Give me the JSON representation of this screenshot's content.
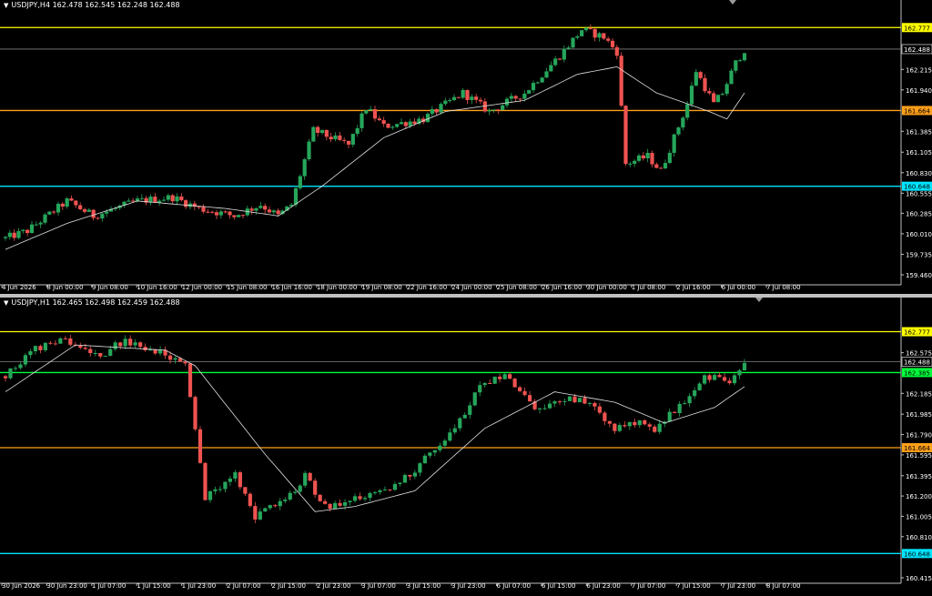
{
  "colors": {
    "background": "#000000",
    "bull": "#26a65b",
    "bear": "#ef5350",
    "ma_line": "#e0e0e0",
    "axis_text": "#ffffff",
    "yellow_level": "#ffff00",
    "orange_level": "#ff9f1a",
    "green_level": "#00ff3c",
    "cyan_level": "#00e5ff",
    "current_level": "#808080"
  },
  "panels": [
    {
      "title": "USDJPY,H4",
      "ohlc": "162.478 162.545 162.248 162.488",
      "header_icon": "dropdown-triangle-icon"
    },
    {
      "title": "USDJPY,H1",
      "ohlc": "162.465 162.498 162.459 162.488",
      "header_icon": "dropdown-triangle-icon"
    }
  ],
  "chart_data": [
    {
      "type": "candlestick",
      "symbol": "USDJPY",
      "timeframe": "H4",
      "ylim": [
        159.35,
        163.0
      ],
      "price_ticks": [
        "162.215",
        "161.940",
        "161.385",
        "161.105",
        "160.830",
        "160.555",
        "160.285",
        "160.010",
        "159.735",
        "159.460"
      ],
      "time_labels": [
        "4 Jun 2026",
        "8 Jun 00:00",
        "9 Jun 08:00",
        "10 Jun 16:00",
        "12 Jun 00:00",
        "15 Jun 08:00",
        "16 Jun 16:00",
        "18 Jun 00:00",
        "19 Jun 08:00",
        "22 Jun 16:00",
        "24 Jun 00:00",
        "25 Jun 08:00",
        "26 Jun 16:00",
        "30 Jun 00:00",
        "1 Jul 08:00",
        "2 Jul 16:00",
        "6 Jul 00:00",
        "7 Jul 08:00"
      ],
      "levels": [
        {
          "price": 162.777,
          "label": "162.777",
          "color": "#ffff00"
        },
        {
          "price": 162.488,
          "label": "162.488",
          "color": "#808080"
        },
        {
          "price": 161.664,
          "label": "161.664",
          "color": "#ff9f1a"
        },
        {
          "price": 160.648,
          "label": "160.648",
          "color": "#00e5ff"
        }
      ],
      "anchors": [
        [
          0,
          159.95
        ],
        [
          5,
          160.05
        ],
        [
          14,
          160.45
        ],
        [
          20,
          160.25
        ],
        [
          30,
          160.45
        ],
        [
          38,
          160.5
        ],
        [
          44,
          160.35
        ],
        [
          52,
          160.25
        ],
        [
          58,
          160.4
        ],
        [
          62,
          160.25
        ],
        [
          65,
          160.4
        ],
        [
          70,
          161.4
        ],
        [
          78,
          161.2
        ],
        [
          82,
          161.7
        ],
        [
          86,
          161.45
        ],
        [
          95,
          161.55
        ],
        [
          104,
          161.9
        ],
        [
          110,
          161.65
        ],
        [
          118,
          161.9
        ],
        [
          126,
          162.4
        ],
        [
          131,
          162.75
        ],
        [
          136,
          162.65
        ],
        [
          139,
          162.45
        ],
        [
          141,
          160.95
        ],
        [
          146,
          161.05
        ],
        [
          149,
          160.85
        ],
        [
          155,
          161.75
        ],
        [
          157,
          162.2
        ],
        [
          161,
          161.75
        ],
        [
          163,
          161.9
        ],
        [
          166,
          162.3
        ],
        [
          168,
          162.48
        ]
      ],
      "ma_anchors": [
        [
          0,
          159.8
        ],
        [
          14,
          160.15
        ],
        [
          30,
          160.45
        ],
        [
          50,
          160.35
        ],
        [
          62,
          160.25
        ],
        [
          72,
          160.65
        ],
        [
          86,
          161.3
        ],
        [
          100,
          161.65
        ],
        [
          118,
          161.8
        ],
        [
          130,
          162.15
        ],
        [
          139,
          162.25
        ],
        [
          148,
          161.9
        ],
        [
          160,
          161.65
        ],
        [
          164,
          161.55
        ],
        [
          168,
          161.9
        ]
      ]
    },
    {
      "type": "candlestick",
      "symbol": "USDJPY",
      "timeframe": "H1",
      "ylim": [
        160.38,
        163.0
      ],
      "price_ticks": [
        "162.575",
        "162.185",
        "161.985",
        "161.790",
        "161.595",
        "161.395",
        "161.200",
        "161.005",
        "160.810",
        "160.415"
      ],
      "time_labels": [
        "30 Jun 2026",
        "30 Jun 23:00",
        "1 Jul 07:00",
        "1 Jul 15:00",
        "1 Jul 23:00",
        "2 Jul 07:00",
        "2 Jul 15:00",
        "2 Jul 23:00",
        "3 Jul 07:00",
        "3 Jul 15:00",
        "3 Jul 23:00",
        "6 Jul 07:00",
        "6 Jul 15:00",
        "6 Jul 23:00",
        "7 Jul 07:00",
        "7 Jul 15:00",
        "7 Jul 23:00",
        "8 Jul 07:00"
      ],
      "levels": [
        {
          "price": 162.777,
          "label": "162.777",
          "color": "#ffff00"
        },
        {
          "price": 162.488,
          "label": "162.488",
          "color": "#808080"
        },
        {
          "price": 162.385,
          "label": "162.385",
          "color": "#00ff3c"
        },
        {
          "price": 161.664,
          "label": "161.664",
          "color": "#ff9f1a"
        },
        {
          "price": 160.648,
          "label": "160.648",
          "color": "#00e5ff"
        }
      ],
      "anchors": [
        [
          0,
          162.35
        ],
        [
          5,
          162.6
        ],
        [
          12,
          162.7
        ],
        [
          19,
          162.55
        ],
        [
          24,
          162.7
        ],
        [
          32,
          162.55
        ],
        [
          36,
          162.45
        ],
        [
          40,
          161.2
        ],
        [
          46,
          161.4
        ],
        [
          50,
          161.0
        ],
        [
          56,
          161.15
        ],
        [
          60,
          161.4
        ],
        [
          64,
          161.1
        ],
        [
          68,
          161.15
        ],
        [
          74,
          161.2
        ],
        [
          82,
          161.45
        ],
        [
          90,
          161.85
        ],
        [
          95,
          162.25
        ],
        [
          100,
          162.38
        ],
        [
          106,
          162.05
        ],
        [
          115,
          162.15
        ],
        [
          122,
          161.85
        ],
        [
          126,
          161.9
        ],
        [
          130,
          161.85
        ],
        [
          135,
          162.05
        ],
        [
          140,
          162.35
        ],
        [
          145,
          162.3
        ],
        [
          148,
          162.48
        ]
      ],
      "ma_anchors": [
        [
          0,
          162.2
        ],
        [
          14,
          162.65
        ],
        [
          32,
          162.6
        ],
        [
          38,
          162.45
        ],
        [
          52,
          161.6
        ],
        [
          62,
          161.05
        ],
        [
          70,
          161.1
        ],
        [
          82,
          161.25
        ],
        [
          96,
          161.85
        ],
        [
          110,
          162.2
        ],
        [
          122,
          162.1
        ],
        [
          132,
          161.9
        ],
        [
          142,
          162.05
        ],
        [
          148,
          162.25
        ]
      ]
    }
  ]
}
